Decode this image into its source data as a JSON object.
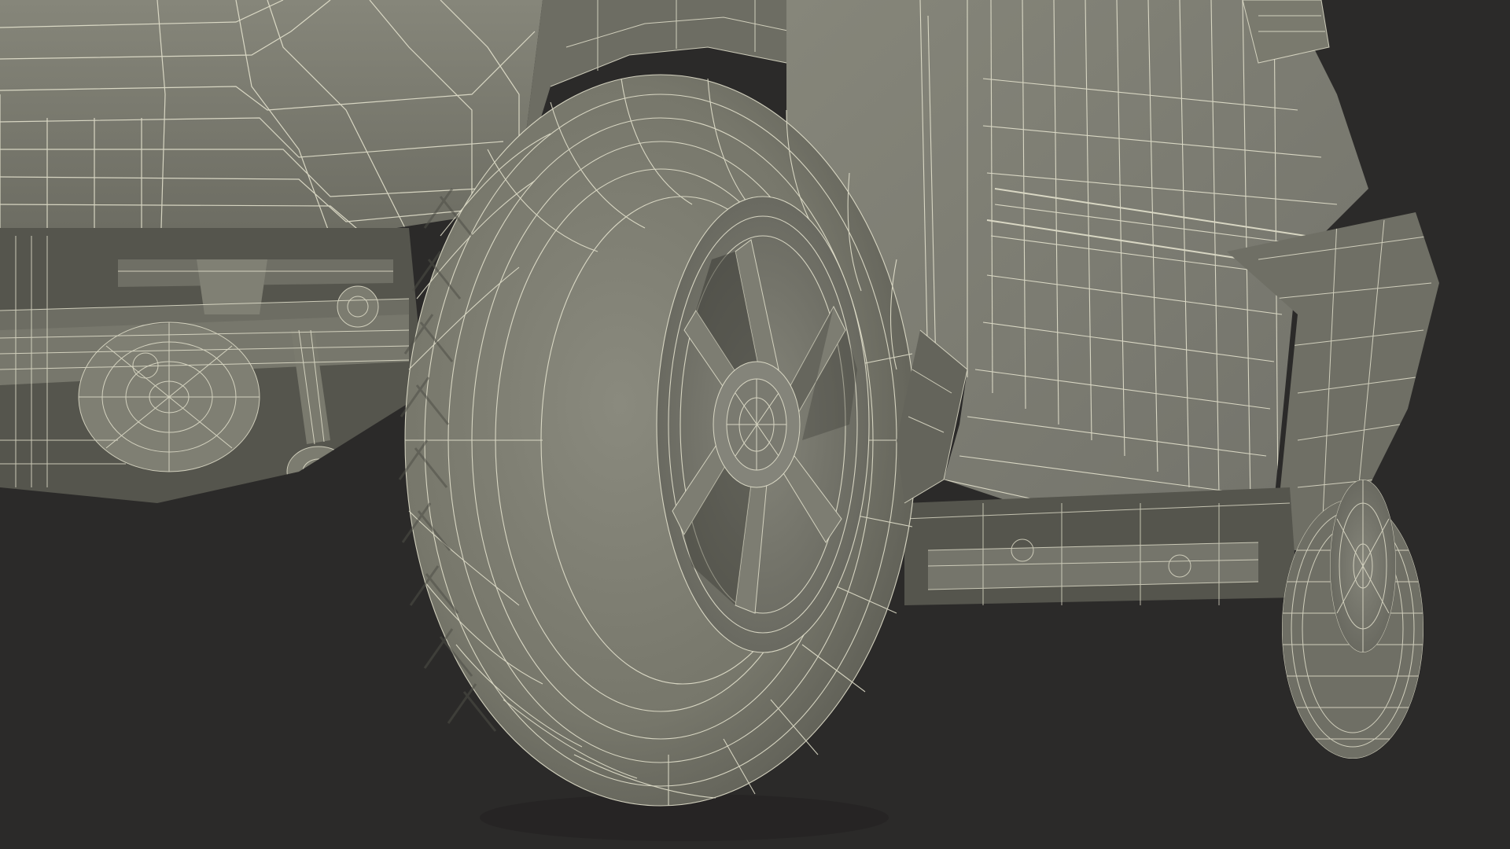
{
  "scene": {
    "subject": "wireframe-render-vehicle-underside",
    "palette": {
      "background": "#2b2a29",
      "surface": "#7e7e72",
      "surface_dark": "#5e5e55",
      "surface_light": "#8d8d80",
      "wire": "#e9e7d2",
      "shadow": "#3f3f39"
    }
  }
}
